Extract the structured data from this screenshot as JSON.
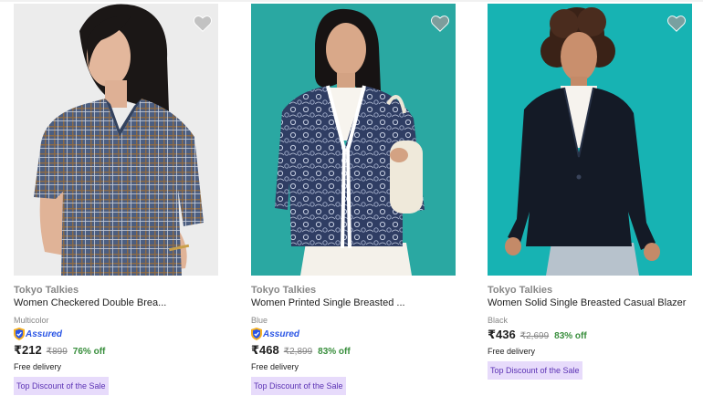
{
  "products": [
    {
      "brand": "Tokyo Talkies",
      "title": "Women Checkered Double Brea...",
      "color": "Multicolor",
      "assured": "Assured",
      "price": "₹212",
      "mrp": "₹899",
      "discount": "76% off",
      "delivery": "Free delivery",
      "badge": "Top Discount of the Sale"
    },
    {
      "brand": "Tokyo Talkies",
      "title": "Women Printed Single Breasted ...",
      "color": "Blue",
      "assured": "Assured",
      "price": "₹468",
      "mrp": "₹2,899",
      "discount": "83% off",
      "delivery": "Free delivery",
      "badge": "Top Discount of the Sale"
    },
    {
      "brand": "Tokyo Talkies",
      "title": "Women Solid Single Breasted Casual Blazer",
      "color": "Black",
      "price": "₹436",
      "mrp": "₹2,699",
      "discount": "83% off",
      "delivery": "Free delivery",
      "badge": "Top Discount of the Sale"
    }
  ],
  "icons": {
    "wishlist": "heart-icon",
    "assured": "flipkart-assured-shield-icon"
  },
  "colors": {
    "discount": "#388e3c",
    "badge_bg": "#e7dbfb",
    "badge_text": "#5b32b4",
    "assured": "#2a55e5",
    "muted": "#878787"
  }
}
